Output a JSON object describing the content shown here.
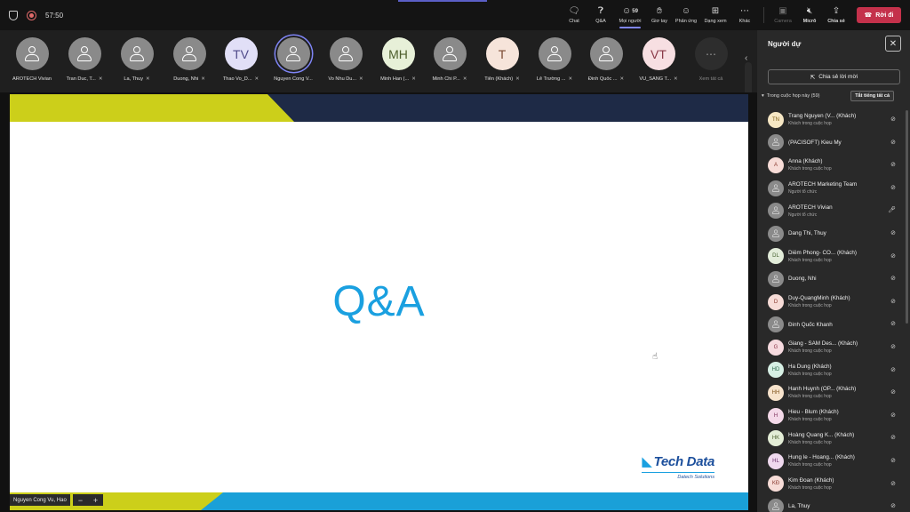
{
  "topbar": {
    "timer": "57:50",
    "buttons": [
      {
        "id": "chat",
        "label": "Chat",
        "icon": "chat-icon"
      },
      {
        "id": "qa",
        "label": "Q&A",
        "icon": "qa-icon"
      },
      {
        "id": "people",
        "label": "Mọi người",
        "icon": "people-icon",
        "count": "59"
      },
      {
        "id": "raise",
        "label": "Giơ tay",
        "icon": "hand-icon"
      },
      {
        "id": "react",
        "label": "Phản ứng",
        "icon": "smile-icon"
      },
      {
        "id": "view",
        "label": "Dạng xem",
        "icon": "grid-icon"
      },
      {
        "id": "more",
        "label": "Khác",
        "icon": "more-icon"
      }
    ],
    "camera_label": "Camera",
    "mic_label": "Micrô",
    "share_label": "Chia sẻ",
    "leave_label": "Rời đi"
  },
  "strip": {
    "tiles": [
      {
        "name": "AROTECH Vivian",
        "initials": "",
        "muted": false
      },
      {
        "name": "Tran Duc, T...",
        "initials": "",
        "muted": true
      },
      {
        "name": "La, Thuy",
        "initials": "",
        "muted": true
      },
      {
        "name": "Duong, Nhi",
        "initials": "",
        "muted": true
      },
      {
        "name": "Thao Vo_D...",
        "initials": "TV",
        "muted": true
      },
      {
        "name": "Nguyen Cong V...",
        "initials": "",
        "muted": false
      },
      {
        "name": "Vo Nhu Du...",
        "initials": "",
        "muted": true
      },
      {
        "name": "Minh Han (...",
        "initials": "MH",
        "muted": true
      },
      {
        "name": "Minh Chi P...",
        "initials": "",
        "muted": true
      },
      {
        "name": "Tiên (Khách)",
        "initials": "T",
        "muted": true
      },
      {
        "name": "Lê Trường ...",
        "initials": "",
        "muted": true
      },
      {
        "name": "Đinh Quốc ...",
        "initials": "",
        "muted": true
      },
      {
        "name": "VŨ_SÁNG T...",
        "initials": "VT",
        "muted": true
      }
    ],
    "view_all_label": "Xem tất cả"
  },
  "slide": {
    "title": "Q&A",
    "logo_brand": "Tech Data",
    "logo_tagline": "Datech Solutions"
  },
  "presenter": {
    "name": "Nguyen Cong Vu, Hao",
    "zoom_out": "−",
    "zoom_in": "+"
  },
  "panel": {
    "title": "Người dự",
    "invite_label": "Chia sẻ lời mời",
    "section_label": "Trong cuộc họp này (59)",
    "mute_all_label": "Tắt tiếng tất cả",
    "participants": [
      {
        "name": "Trang Nguyen (V... (Khách)",
        "sub": "Khách trong cuộc họp",
        "initials": "TN",
        "color": "c-tn",
        "mic": "muted"
      },
      {
        "name": "(PACISOFT) Kieu My",
        "sub": "",
        "initials": "",
        "color": "g",
        "mic": "muted"
      },
      {
        "name": "Anna (Khách)",
        "sub": "Khách trong cuộc họp",
        "initials": "A",
        "color": "c-a",
        "mic": "muted"
      },
      {
        "name": "AROTECH Marketing Team",
        "sub": "Người tổ chức",
        "initials": "",
        "color": "g",
        "mic": "muted"
      },
      {
        "name": "AROTECH Vivian",
        "sub": "Người tổ chức",
        "initials": "",
        "color": "g",
        "mic": "on"
      },
      {
        "name": "Dang Thi, Thuy",
        "sub": "",
        "initials": "",
        "color": "g",
        "mic": "muted"
      },
      {
        "name": "Diễm Phong- CÔ... (Khách)",
        "sub": "Khách trong cuộc họp",
        "initials": "DL",
        "color": "c-dl",
        "mic": "muted"
      },
      {
        "name": "Duong, Nhi",
        "sub": "",
        "initials": "",
        "color": "g",
        "mic": "muted"
      },
      {
        "name": "Duy-QuangMinh (Khách)",
        "sub": "Khách trong cuộc họp",
        "initials": "D",
        "color": "c-d",
        "mic": "muted"
      },
      {
        "name": "Đinh Quốc Khanh",
        "sub": "",
        "initials": "",
        "color": "g",
        "mic": "muted"
      },
      {
        "name": "Giang - SAM Des... (Khách)",
        "sub": "Khách trong cuộc họp",
        "initials": "G",
        "color": "c-gi",
        "mic": "muted"
      },
      {
        "name": "Ha Dung (Khách)",
        "sub": "Khách trong cuộc họp",
        "initials": "HD",
        "color": "c-hd",
        "mic": "muted"
      },
      {
        "name": "Hanh Huynh (OP... (Khách)",
        "sub": "Khách trong cuộc họp",
        "initials": "HH",
        "color": "c-hh",
        "mic": "muted"
      },
      {
        "name": "Hieu - Blum (Khách)",
        "sub": "Khách trong cuộc họp",
        "initials": "H",
        "color": "c-h",
        "mic": "muted"
      },
      {
        "name": "Hoàng Quang K... (Khách)",
        "sub": "Khách trong cuộc họp",
        "initials": "HK",
        "color": "c-hk",
        "mic": "muted"
      },
      {
        "name": "Hung le - Hoang... (Khách)",
        "sub": "Khách trong cuộc họp",
        "initials": "HL",
        "color": "c-hl",
        "mic": "muted"
      },
      {
        "name": "Kim Đoan (Khách)",
        "sub": "Khách trong cuộc họp",
        "initials": "KĐ",
        "color": "c-kd",
        "mic": "muted"
      },
      {
        "name": "La, Thuy",
        "sub": "",
        "initials": "",
        "color": "g",
        "mic": "muted"
      }
    ]
  },
  "colors": {
    "accent": "#5b5fc7",
    "leave": "#c4314b",
    "slide_blue": "#1aa0e0",
    "slide_yellow": "#cccf1a",
    "slide_navy": "#1e2a46"
  }
}
